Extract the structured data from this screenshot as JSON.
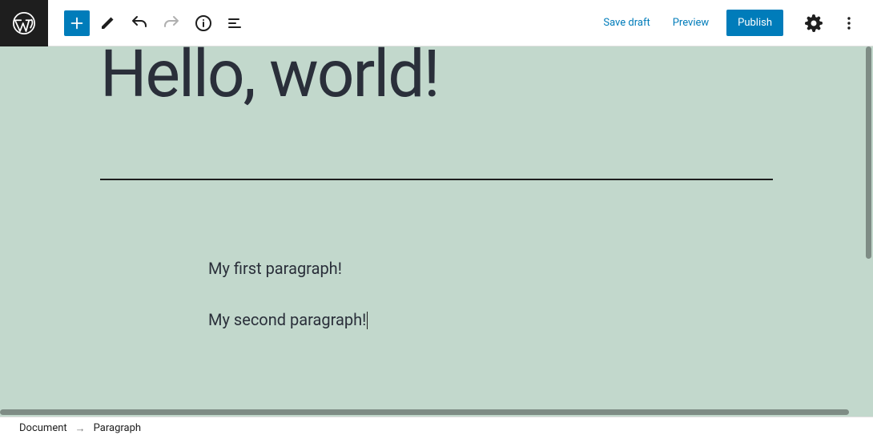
{
  "toolbar": {
    "save_draft": "Save draft",
    "preview": "Preview",
    "publish": "Publish"
  },
  "editor": {
    "title": "Hello, world!",
    "paragraphs": [
      "My first paragraph!",
      "My second paragraph!"
    ]
  },
  "breadcrumb": {
    "root": "Document",
    "current": "Paragraph"
  }
}
